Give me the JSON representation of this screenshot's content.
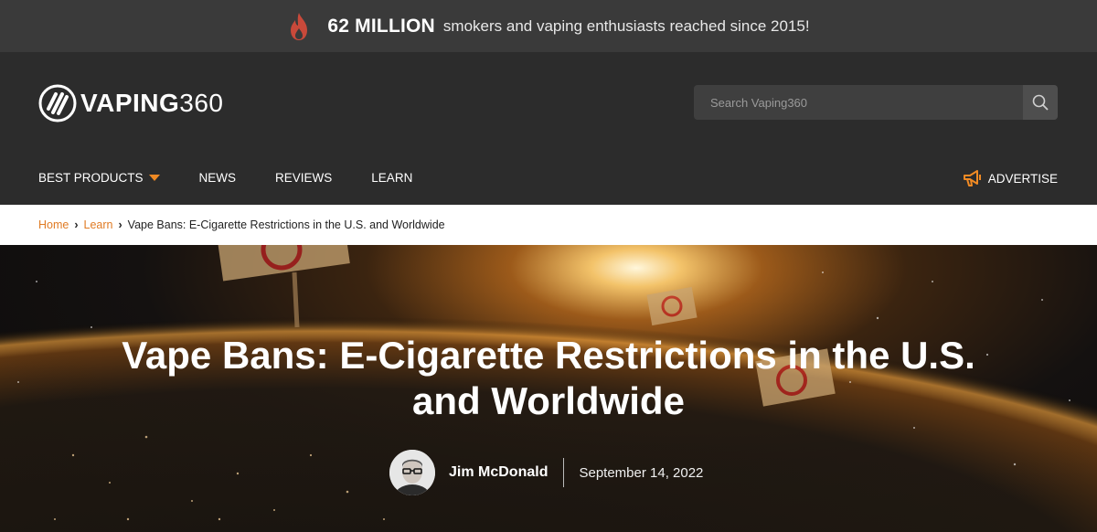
{
  "promo": {
    "highlight": "62 MILLION",
    "text": "smokers and vaping enthusiasts reached since 2015!",
    "icon": "flame-icon"
  },
  "header": {
    "logo_bold": "VAPING",
    "logo_light": "360",
    "search_placeholder": "Search Vaping360",
    "nav": [
      {
        "label": "BEST PRODUCTS"
      },
      {
        "label": "NEWS"
      },
      {
        "label": "REVIEWS"
      },
      {
        "label": "LEARN"
      }
    ],
    "advertise": "ADVERTISE"
  },
  "breadcrumb": {
    "home": "Home",
    "learn": "Learn",
    "current": "Vape Bans: E-Cigarette Restrictions in the U.S. and Worldwide"
  },
  "article": {
    "title": "Vape Bans: E-Cigarette Restrictions in the U.S. and Worldwide",
    "author": "Jim McDonald",
    "date": "September 14, 2022"
  },
  "colors": {
    "accent": "#f08a24",
    "promo_bg": "#3a3a3a",
    "header_bg": "#2c2c2c",
    "breadcrumb_link": "#e07b24"
  }
}
